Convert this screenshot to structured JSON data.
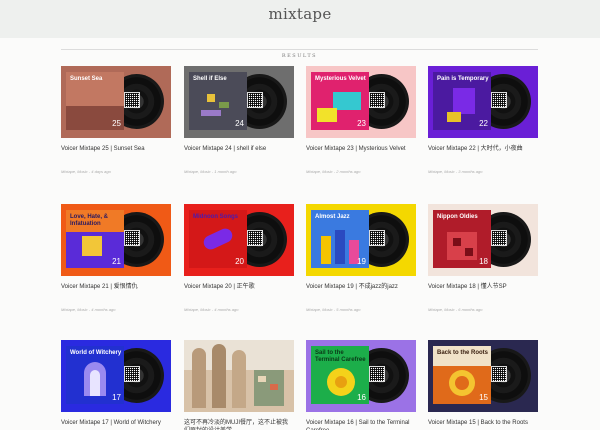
{
  "site": {
    "title": "mixtape"
  },
  "section": {
    "label": "RESULTS"
  },
  "cards": [
    {
      "title": "Voicer Mixtape 25 | Sunset Sea",
      "meta": "Mixtape, Music - 4 days ago",
      "cover_text": "Sunset Sea",
      "number": "25",
      "bg": "#b06a58",
      "cover": "#c27862"
    },
    {
      "title": "Voicer Mixtape 24 | shell if else",
      "meta": "Mixtape, Music - 1 month ago",
      "cover_text": "Shell if Else",
      "number": "24",
      "bg": "#6e6e6e",
      "cover": "#4b4b58"
    },
    {
      "title": "Voicer Mixtape 23 | Mysterious Velvet",
      "meta": "Mixtape, Music - 2 months ago",
      "cover_text": "Mysterious Velvet",
      "number": "23",
      "bg": "#f7c6c6",
      "cover": "#e0226e"
    },
    {
      "title": "Voicer Mixtape 22 | 大时代，小夜曲",
      "meta": "Mixtape, Music - 3 months ago",
      "cover_text": "Pain is Temporary",
      "number": "22",
      "bg": "#6a1fd6",
      "cover": "#4b1aa0"
    },
    {
      "title": "Voicer Mixtape 21 | 爱恨情仇",
      "meta": "Mixtape, Music - 4 months ago",
      "cover_text": "Love, Hate, & Infatuation",
      "number": "21",
      "bg": "#f05a16",
      "cover": "#5a2bd8"
    },
    {
      "title": "Voicer Mixtape 20 | 正午歌",
      "meta": "Mixtape, Music - 4 months ago",
      "cover_text": "Midnoon Songs",
      "number": "20",
      "bg": "#e8201c",
      "cover": "#d41818"
    },
    {
      "title": "Voicer Mixtape 19 | 不成jazz的jazz",
      "meta": "Mixtape, Music - 5 months ago",
      "cover_text": "Almost Jazz",
      "number": "19",
      "bg": "#f4d800",
      "cover": "#3a7ae0"
    },
    {
      "title": "Voicer Mixtape 18 | 懂人节SP",
      "meta": "Mixtape, Music - 6 months ago",
      "cover_text": "Nippon Oldies",
      "number": "18",
      "bg": "#f2e4dc",
      "cover": "#b01c2a"
    },
    {
      "title": "Voicer Mixtape 17 | World of Witchery",
      "meta": "",
      "cover_text": "World of Witchery",
      "number": "17",
      "bg": "#2a2ae0",
      "cover": "#2230d0"
    },
    {
      "title": "这可不再冷淡的MUJI餐厅，这不止被我们原封的设计美学",
      "meta": "",
      "cover_text": "",
      "number": "",
      "bg": "#d8c2a8",
      "cover": ""
    },
    {
      "title": "Voicer Mixtape 16 | Sail to the Terminal Carefree",
      "meta": "",
      "cover_text": "Sail to the Terminal Carefree",
      "number": "16",
      "bg": "#9b72e6",
      "cover": "#1cae4a"
    },
    {
      "title": "Voicer Mixtape 15 | Back to the Roots",
      "meta": "",
      "cover_text": "Back to the Roots",
      "number": "15",
      "bg": "#2a2850",
      "cover": "#e06a1a"
    }
  ]
}
